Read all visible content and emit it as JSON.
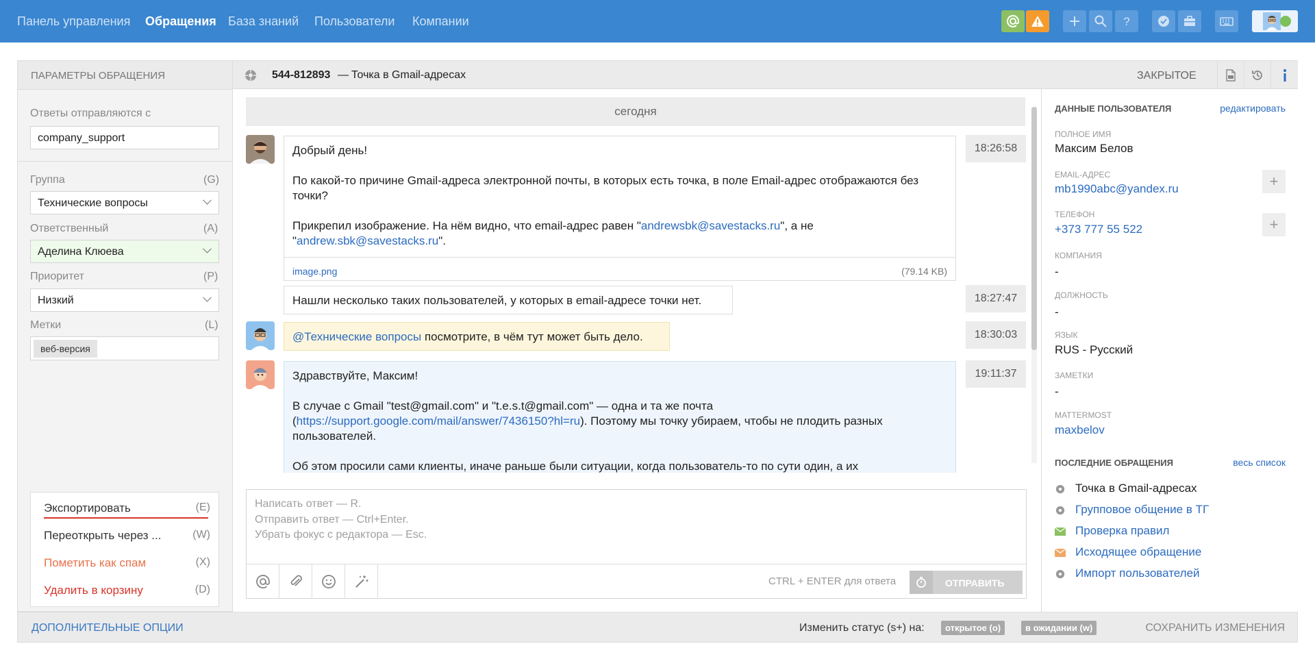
{
  "nav": {
    "items": [
      "Панель управления",
      "Обращения",
      "База знаний",
      "Пользователи",
      "Компании"
    ]
  },
  "left": {
    "header": "ПАРАМЕТРЫ ОБРАЩЕНИЯ",
    "sender_label": "Ответы отправляются с",
    "sender_value": "company_support",
    "group_label": "Группа",
    "group_key": "(G)",
    "group_value": "Технические вопросы",
    "assignee_label": "Ответственный",
    "assignee_key": "(A)",
    "assignee_value": "Аделина Клюева",
    "priority_label": "Приоритет",
    "priority_key": "(P)",
    "priority_value": "Низкий",
    "tags_label": "Метки",
    "tags_key": "(L)",
    "tag": "веб-версия",
    "actions": [
      {
        "label": "Экспортировать",
        "key": "(E)",
        "color": "#333333"
      },
      {
        "label": "Переоткрыть через ...",
        "key": "(W)",
        "color": "#333333"
      },
      {
        "label": "Пометить как спам",
        "key": "(X)",
        "color": "#e8724a"
      },
      {
        "label": "Удалить в корзину",
        "key": "(D)",
        "color": "#d9342b"
      }
    ]
  },
  "ticket": {
    "id": "544-812893",
    "dash": "—",
    "title": "Точка в Gmail-адресах",
    "status": "ЗАКРЫТОЕ"
  },
  "chat": {
    "date": "сегодня",
    "m1": {
      "time": "18:26:58",
      "p1": "Добрый день!",
      "p2": "По какой-то причине Gmail-адреса электронной почты, в которых есть точка, в поле Email-адрес отображаются без точки?",
      "p3a": "Прикрепил изображение. На нём видно, что email-адрес равен \"",
      "p3b": "andrewsbk@savestacks.ru",
      "p3c": "\", а не \"",
      "p3d": "andrew.sbk@savestacks.ru",
      "p3e": "\".",
      "file": "image.png",
      "size": "(79.14 KB)"
    },
    "m2": {
      "time": "18:27:47",
      "text": "Нашли несколько таких пользователей, у которых в email-адресе точки нет."
    },
    "m3": {
      "time": "18:30:03",
      "mention": "@Технические вопросы",
      "text": " посмотрите, в чём тут может быть дело."
    },
    "m4": {
      "time": "19:11:37",
      "p1": "Здравствуйте, Максим!",
      "p2a": "В случае с Gmail \"test@gmail.com\" и \"t.e.s.t@gmail.com\" — одна и та же почта (",
      "p2b": "https://support.google.com/mail/answer/7436150?hl=ru",
      "p2c": "). Поэтому мы точку убираем, чтобы не плодить разных пользователей.",
      "p3": "Об этом просили сами клиенты, иначе раньше были ситуации, когда пользователь-то по сути один, а их"
    }
  },
  "composer": {
    "ph1": "Написать ответ — R.",
    "ph2": "Отправить ответ — Ctrl+Enter.",
    "ph3": "Убрать фокус с редактора — Esc.",
    "hint": "CTRL + ENTER для ответа",
    "send": "ОТПРАВИТЬ"
  },
  "user": {
    "title": "ДАННЫЕ ПОЛЬЗОВАТЕЛЯ",
    "edit": "редактировать",
    "fullname_k": "ПОЛНОЕ ИМЯ",
    "fullname": "Максим Белов",
    "email_k": "EMAIL-АДРЕС",
    "email": "mb1990abc@yandex.ru",
    "phone_k": "ТЕЛЕФОН",
    "phone": "+373 777 55 522",
    "company_k": "КОМПАНИЯ",
    "company": "-",
    "position_k": "ДОЛЖНОСТЬ",
    "position": "-",
    "lang_k": "ЯЗЫК",
    "lang": "RUS - Русский",
    "notes_k": "ЗАМЕТКИ",
    "notes": "-",
    "mm_k": "MATTERMOST",
    "mm": "maxbelov",
    "plus": "+"
  },
  "recent": {
    "title": "ПОСЛЕДНИЕ ОБРАЩЕНИЯ",
    "all": "весь список",
    "items": [
      {
        "label": "Точка в Gmail-адресах",
        "icon": "ticket-icon"
      },
      {
        "label": "Групповое общение в ТГ",
        "icon": "ticket-icon"
      },
      {
        "label": "Проверка правил",
        "icon": "mail-icon"
      },
      {
        "label": "Исходящее обращение",
        "icon": "mail-icon"
      },
      {
        "label": "Импорт пользователей",
        "icon": "ticket-icon"
      }
    ]
  },
  "footer": {
    "extra": "ДОПОЛНИТЕЛЬНЫЕ ОПЦИИ",
    "status_label": "Изменить статус (s+) на:",
    "open": "открытое (o)",
    "waiting": "в ожидании (w)",
    "save": "СОХРАНИТЬ ИЗМЕНЕНИЯ"
  },
  "colors": {
    "brand": "#3a86d0",
    "link": "#2c6bbf",
    "green": "#7cc05a",
    "orange": "#f59b2d",
    "mail_green": "#8cc063",
    "mail_orange": "#f0a868"
  }
}
